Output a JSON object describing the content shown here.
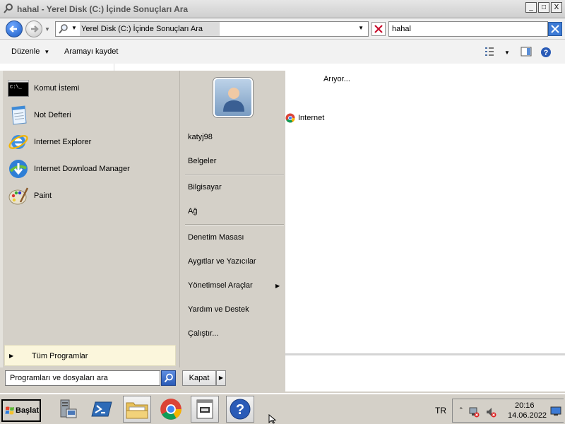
{
  "window": {
    "title": "hahal - Yerel Disk (C:) İçinde Sonuçları Ara",
    "controls": [
      "_",
      "□",
      "X"
    ]
  },
  "address_bar": {
    "path": "Yerel Disk (C:) İçinde Sonuçları Ara",
    "search_value": "hahal"
  },
  "command_bar": {
    "organize": "Düzenle",
    "save_search": "Aramayı kaydet"
  },
  "results": {
    "status": "Arıyor...",
    "items": [
      {
        "label": "Internet",
        "icon": "chrome-icon"
      }
    ]
  },
  "start_menu": {
    "pinned": [
      {
        "label": "Komut İstemi",
        "icon": "cmd-icon"
      },
      {
        "label": "Not Defteri",
        "icon": "notepad-icon"
      },
      {
        "label": "Internet Explorer",
        "icon": "ie-icon"
      },
      {
        "label": "Internet Download Manager",
        "icon": "idm-icon"
      },
      {
        "label": "Paint",
        "icon": "paint-icon"
      }
    ],
    "all_programs": "Tüm Programlar",
    "search_placeholder": "Programları ve dosyaları ara",
    "shutdown": "Kapat",
    "right": {
      "user": "katyj98",
      "documents": "Belgeler",
      "computer": "Bilgisayar",
      "network": "Ağ",
      "control_panel": "Denetim Masası",
      "devices": "Aygıtlar ve Yazıcılar",
      "admin_tools": "Yönetimsel Araçlar",
      "help": "Yardım ve Destek",
      "run": "Çalıştır..."
    }
  },
  "taskbar": {
    "start": "Başlat",
    "apps": [
      "server-manager-icon",
      "powershell-icon",
      "explorer-icon",
      "chrome-icon",
      "notepad-icon",
      "help-icon"
    ],
    "language": "TR",
    "time": "20:16",
    "date": "14.06.2022"
  },
  "colors": {
    "accent_blue": "#2a5bb7",
    "start_bg": "#d4d0c8",
    "all_programs_bg": "#fbf6dc"
  }
}
